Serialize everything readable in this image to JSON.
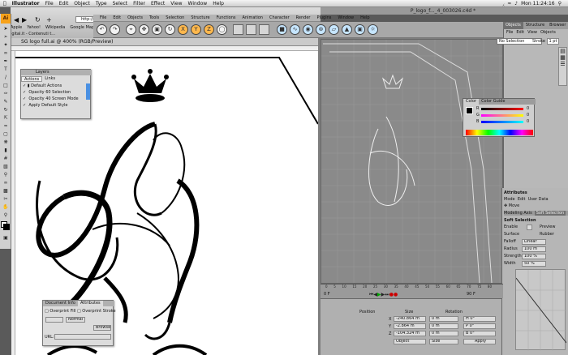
{
  "menubar": {
    "items": [
      "Illustrator",
      "File",
      "Edit",
      "Object",
      "Type",
      "Select",
      "Filter",
      "Effect",
      "View",
      "Window",
      "Help"
    ],
    "clock": "Mon 11:24:16"
  },
  "c4d_title": "P_logo_f..._4_003026.c4d *",
  "browser": {
    "url": "http://www.c4c",
    "bookmarks": [
      "Apple",
      "Yahoo!",
      "Wikipedia",
      "Google Map"
    ],
    "tab": "igital.it - Contenuti t..."
  },
  "c4d_menu": [
    "File",
    "Edit",
    "Objects",
    "Tools",
    "Selection",
    "Structure",
    "Functions",
    "Animation",
    "Character",
    "Render",
    "Plugins",
    "Window",
    "Help"
  ],
  "doc_tab": "SG logo full.ai @ 400% (RGB/Preview)",
  "layers_panel": {
    "tabs": [
      "Actions",
      "Links"
    ],
    "title": "Layers",
    "rows": [
      "Default Actions",
      "Opacity 60 Selection",
      "Opacity 40 Screen Mode",
      "Apply Default Style"
    ]
  },
  "docinfo_panel": {
    "tabs": [
      "Document Info",
      "Attributes"
    ],
    "rows": [
      "Overprint Fill",
      "Overprint Stroke"
    ],
    "mode_label": "Normal",
    "fields": [
      "",
      "Overlay",
      "Browse"
    ],
    "url_label": "URL:"
  },
  "color_panel": {
    "tabs": [
      "Color",
      "Color Guide"
    ],
    "channels": [
      {
        "label": "R",
        "value": "0"
      },
      {
        "label": "G",
        "value": "0"
      },
      {
        "label": "B",
        "value": "0"
      }
    ]
  },
  "object_panel": {
    "tabs": [
      "Objects",
      "Structure",
      "Browser"
    ],
    "subtabs": [
      "File",
      "Edit",
      "View",
      "Objects"
    ],
    "no_selection": "No Selection",
    "stroke_label": "Stroke",
    "stroke_value": "1 pt"
  },
  "attributes": {
    "title": "Attributes",
    "menu": [
      "Mode",
      "Edit",
      "User Data"
    ],
    "tool": "Move",
    "tabs": [
      "Modeling Axis",
      "Soft Selection",
      "Visualization"
    ],
    "section": "Soft Selection",
    "rows": [
      {
        "label": "Enable",
        "value": ""
      },
      {
        "label": "Surface",
        "value": "Rubber"
      },
      {
        "label": "Falloff",
        "value": "Linear"
      },
      {
        "label": "Radius",
        "value": "100 m"
      },
      {
        "label": "Strength",
        "value": "100 %"
      },
      {
        "label": "Width",
        "value": "50 %"
      }
    ],
    "preview_label": "Preview",
    "restrict_label": "Restrict"
  },
  "coords_panel": {
    "headers": [
      "Position",
      "Size",
      "Rotation"
    ],
    "rows": [
      {
        "axis": "X",
        "pos": "-240.864 m",
        "size": "0 m",
        "rot": "H 0°"
      },
      {
        "axis": "Y",
        "pos": "-2.864 m",
        "size": "0 m",
        "rot": "P 0°"
      },
      {
        "axis": "Z",
        "pos": "-104.324 m",
        "size": "0 m",
        "rot": "B 0°"
      }
    ],
    "mode_object": "Object",
    "mode_size": "Size",
    "apply": "Apply"
  },
  "timeline": {
    "ticks": [
      "0",
      "5",
      "10",
      "15",
      "20",
      "25",
      "30",
      "35",
      "40",
      "45",
      "50",
      "55",
      "60",
      "65",
      "70",
      "75",
      "80"
    ],
    "frame": "0 F",
    "end_frame": "90 F"
  },
  "artboard_letters": "SG"
}
